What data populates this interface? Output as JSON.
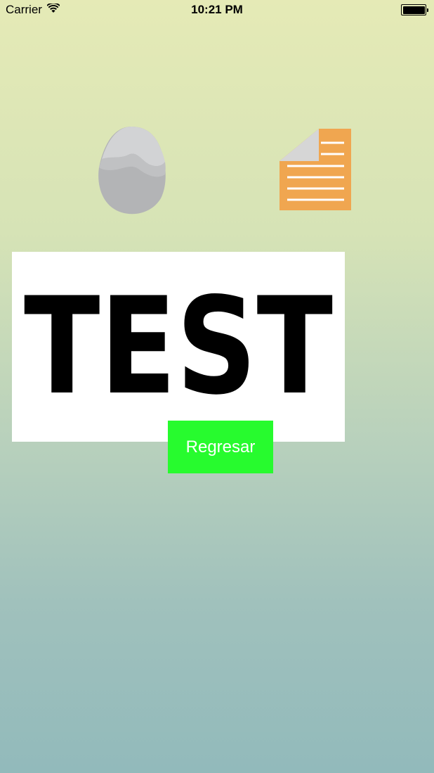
{
  "status_bar": {
    "carrier": "Carrier",
    "time": "10:21 PM",
    "wifi_icon": "wifi-icon",
    "battery_icon": "battery-icon"
  },
  "main": {
    "rock_icon": "rock-icon",
    "paper_icon": "paper-document-icon",
    "test_image_text": "TEST",
    "back_button_label": "Regresar"
  },
  "colors": {
    "button_background": "#27fb2e",
    "button_text": "#ffffff",
    "paper_orange": "#f0a650",
    "rock_gray": "#b9babc"
  }
}
